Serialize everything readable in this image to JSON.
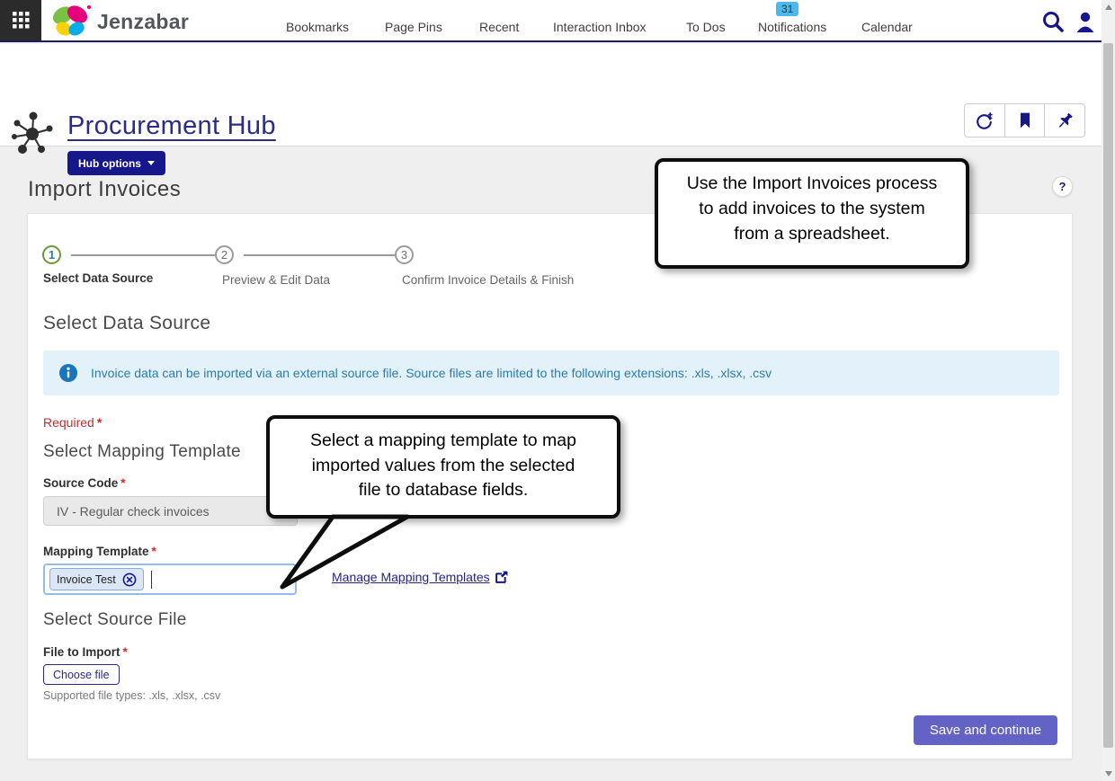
{
  "ui": {
    "star": "*"
  },
  "colors": {
    "navy": "#17178c",
    "purple_button": "#6263c4",
    "badge_blue": "#4cb9ea",
    "info_blue": "#1b75bb",
    "step_green": "#689a31",
    "required_red": "#b53333",
    "banner_bg": "#e3f1fa"
  },
  "nav": {
    "brand": "Jenzabar",
    "items": [
      "Bookmarks",
      "Page Pins",
      "Recent",
      "Interaction Inbox",
      "To Dos",
      "Notifications",
      "Calendar"
    ],
    "notifications_badge": "31"
  },
  "hub": {
    "title": "Procurement Hub",
    "options_button": "Hub options"
  },
  "page": {
    "title": "Import Invoices",
    "help_icon": "?"
  },
  "steps": [
    {
      "num": "1",
      "label": "Select Data Source"
    },
    {
      "num": "2",
      "label": "Preview & Edit Data"
    },
    {
      "num": "3",
      "label": "Confirm Invoice Details & Finish"
    }
  ],
  "section_data_source": {
    "heading": "Select Data Source",
    "info_banner": "Invoice data can be imported via an external source file. Source files are limited to the following extensions: .xls, .xlsx, .csv",
    "required_label": "Required"
  },
  "mapping": {
    "heading": "Select Mapping Template",
    "source_code_label": "Source Code",
    "source_code_value": "IV - Regular check invoices",
    "template_label": "Mapping Template",
    "template_chip": "Invoice Test",
    "manage_link": "Manage Mapping Templates"
  },
  "source_file": {
    "heading": "Select Source File",
    "file_label": "File to Import",
    "choose_button": "Choose file",
    "supported": "Supported file types: .xls, .xlsx, .csv"
  },
  "footer": {
    "save_button": "Save and continue"
  },
  "tooltips": {
    "import_lines": [
      "Use the Import Invoices process",
      "to add invoices to the system",
      "from a spreadsheet."
    ],
    "mapping_lines": [
      "Select a mapping template to map",
      "imported values from the selected",
      "file to database fields."
    ]
  }
}
